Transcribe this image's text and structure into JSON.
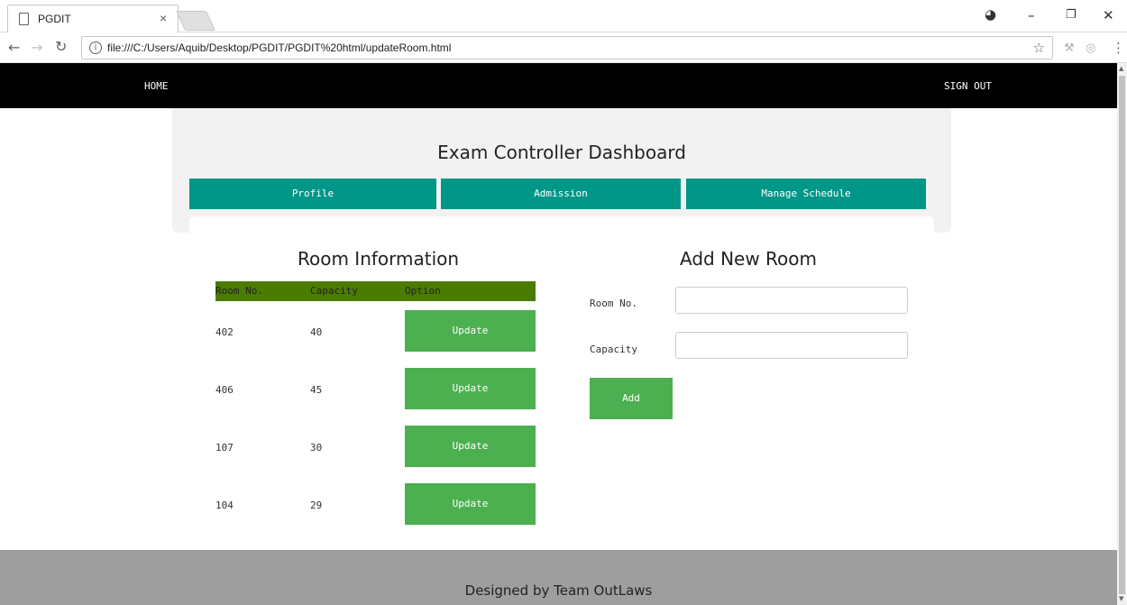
{
  "browser": {
    "tab_title": "PGDIT",
    "tab_close": "×",
    "url": "file:///C:/Users/Aquib/Desktop/PGDIT/PGDIT%20html/updateRoom.html",
    "icons": [
      "page-icon",
      "close-icon",
      "back-icon",
      "forward-icon",
      "reload-icon",
      "info-icon",
      "star-icon",
      "account-icon",
      "minimize-icon",
      "maximize-icon",
      "window-close-icon",
      "menu-icon"
    ]
  },
  "nav": {
    "home": "HOME",
    "sign_out": "SIGN OUT"
  },
  "dashboard": {
    "title": "Exam Controller Dashboard",
    "tabs": [
      "Profile",
      "Admission",
      "Manage Schedule"
    ],
    "accent_color": "#009688"
  },
  "room_info": {
    "title": "Room Information",
    "headers": [
      "Room No.",
      "Capacity",
      "Option"
    ],
    "header_color": "#4a7c00",
    "rows": [
      {
        "room": "402",
        "capacity": "40",
        "action": "Update"
      },
      {
        "room": "406",
        "capacity": "45",
        "action": "Update"
      },
      {
        "room": "107",
        "capacity": "30",
        "action": "Update"
      },
      {
        "room": "104",
        "capacity": "29",
        "action": "Update"
      }
    ],
    "button_color": "#4caf50"
  },
  "add_room": {
    "title": "Add New Room",
    "room_label": "Room No.",
    "capacity_label": "Capacity",
    "room_value": "",
    "capacity_value": "",
    "button": "Add"
  },
  "footer": {
    "text": "Designed by Team OutLaws"
  }
}
